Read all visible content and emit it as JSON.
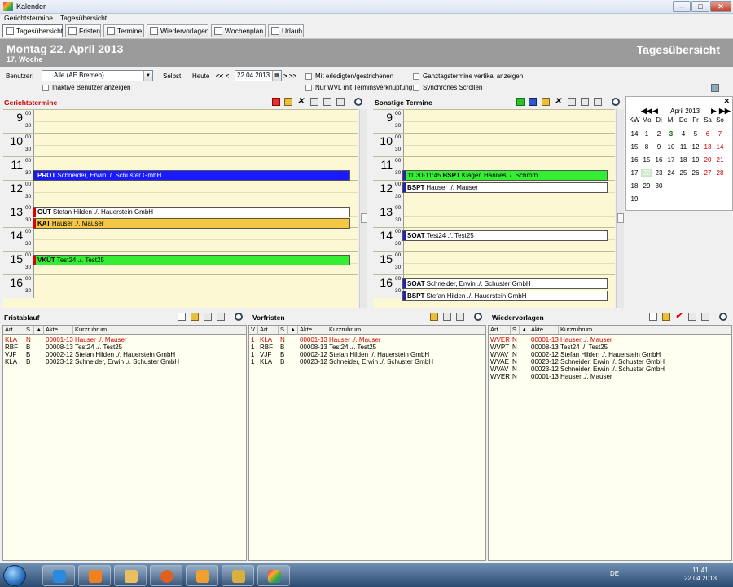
{
  "window": {
    "title": "Kalender"
  },
  "menu": [
    "Gerichtstermine",
    "Tagesübersicht"
  ],
  "toolbar": [
    "Tagesübersicht",
    "Fristen",
    "Termine",
    "Wiedervorlagen",
    "Wochenplan",
    "Urlaub"
  ],
  "header": {
    "date": "Montag 22. April 2013",
    "week": "17. Woche",
    "view": "Tagesübersicht"
  },
  "filters": {
    "benutzer_label": "Benutzer:",
    "benutzer_value": "Alle (AE Bremen)",
    "selbst": "Selbst",
    "heute": "Heute",
    "nav_prev": "<< <",
    "nav_next": "> >>",
    "date_value": "22.04.2013",
    "inactive": "Inaktive Benutzer anzeigen",
    "done": "Mit erledigten/gestrichenen",
    "wvl_only": "Nur WVL mit Terminsverknüpfung",
    "allday": "Ganztagstermine vertikal anzeigen",
    "sync": "Synchrones Scrollen"
  },
  "court": {
    "title": "Gerichtstermine",
    "hours": [
      "9",
      "10",
      "11",
      "12",
      "13",
      "14",
      "15",
      "16"
    ],
    "appointments": [
      {
        "code": "PROT",
        "text": "Schneider, Erwin ./. Schuster GmbH",
        "color": "#1a1aff"
      },
      {
        "code": "GÜT",
        "text": "Stefan Hilden ./. Hauerstein GmbH",
        "color": "#ffffff"
      },
      {
        "code": "KAT",
        "text": "Hauser ./. Mauser",
        "color": "#f4c842"
      },
      {
        "code": "VKÜT",
        "text": "Test24 ./. Test25",
        "color": "#33ee33"
      }
    ]
  },
  "other": {
    "title": "Sonstige Termine",
    "hours": [
      "9",
      "10",
      "11",
      "12",
      "13",
      "14",
      "15",
      "16"
    ],
    "appointments": [
      {
        "time": "11:30-11:45",
        "code": "BSPT",
        "text": "Kläger, Hannes ./. Schroth",
        "color": "#33ee33"
      },
      {
        "code": "BSPT",
        "text": "Hauser ./. Mauser",
        "color": "#ffffff"
      },
      {
        "code": "SOAT",
        "text": "Test24 ./. Test25",
        "color": "#ffffff"
      },
      {
        "code": "SOAT",
        "text": "Schneider, Erwin ./. Schuster GmbH",
        "color": "#ffffff"
      },
      {
        "code": "BSPT",
        "text": "Stefan Hilden ./. Hauerstein GmbH",
        "color": "#ffffff"
      }
    ]
  },
  "minical": {
    "month": "April 2013",
    "headers": [
      "KW",
      "Mo",
      "Di",
      "Mi",
      "Do",
      "Fr",
      "Sa",
      "So"
    ],
    "weeks": [
      [
        "14",
        "1",
        "2",
        "3",
        "4",
        "5",
        "6",
        "7"
      ],
      [
        "15",
        "8",
        "9",
        "10",
        "11",
        "12",
        "13",
        "14"
      ],
      [
        "16",
        "15",
        "16",
        "17",
        "18",
        "19",
        "20",
        "21"
      ],
      [
        "17",
        "22",
        "23",
        "24",
        "25",
        "26",
        "27",
        "28"
      ],
      [
        "18",
        "29",
        "30",
        "",
        "",
        "",
        "",
        ""
      ],
      [
        "19",
        "",
        "",
        "",
        "",
        "",
        "",
        ""
      ]
    ]
  },
  "fristablauf": {
    "title": "Fristablauf",
    "columns": [
      "Art",
      "S",
      "▲",
      "Akte",
      "Kurzrubrum"
    ],
    "rows": [
      [
        "KLA",
        "N",
        "",
        "00001-13",
        "Hauser ./. Mauser"
      ],
      [
        "RBF",
        "B",
        "",
        "00008-13",
        "Test24 ./. Test25"
      ],
      [
        "VJF",
        "B",
        "",
        "00002-12",
        "Stefan Hilden ./. Hauerstein GmbH"
      ],
      [
        "KLA",
        "B",
        "",
        "00023-12",
        "Schneider, Erwin ./. Schuster GmbH"
      ]
    ]
  },
  "vorfristen": {
    "title": "Vorfristen",
    "columns": [
      "V",
      "Art",
      "S",
      "▲",
      "Akte",
      "Kurzrubrum"
    ],
    "rows": [
      [
        "1",
        "KLA",
        "N",
        "",
        "00001-13",
        "Hauser ./. Mauser"
      ],
      [
        "1",
        "RBF",
        "B",
        "",
        "00008-13",
        "Test24 ./. Test25"
      ],
      [
        "1",
        "VJF",
        "B",
        "",
        "00002-12",
        "Stefan Hilden ./. Hauerstein GmbH"
      ],
      [
        "1",
        "KLA",
        "B",
        "",
        "00023-12",
        "Schneider, Erwin ./. Schuster GmbH"
      ]
    ]
  },
  "wiedervorlagen": {
    "title": "Wiedervorlagen",
    "columns": [
      "Art",
      "S",
      "▲",
      "Akte",
      "Kurzrubrum"
    ],
    "rows": [
      [
        "WVER",
        "N",
        "",
        "00001-13",
        "Hauser ./. Mauser"
      ],
      [
        "WVPT",
        "N",
        "",
        "00008-13",
        "Test24 ./. Test25"
      ],
      [
        "WVAV",
        "N",
        "",
        "00002-12",
        "Stefan Hilden ./. Hauerstein GmbH"
      ],
      [
        "WVAE",
        "N",
        "",
        "00023-12",
        "Schneider, Erwin ./. Schuster GmbH"
      ],
      [
        "WVAV",
        "N",
        "",
        "00023-12",
        "Schneider, Erwin ./. Schuster GmbH"
      ],
      [
        "WVER",
        "N",
        "",
        "00001-13",
        "Hauser ./. Mauser"
      ]
    ]
  },
  "taskbar": {
    "lang": "DE",
    "time": "11:41",
    "date": "22.04.2013"
  }
}
